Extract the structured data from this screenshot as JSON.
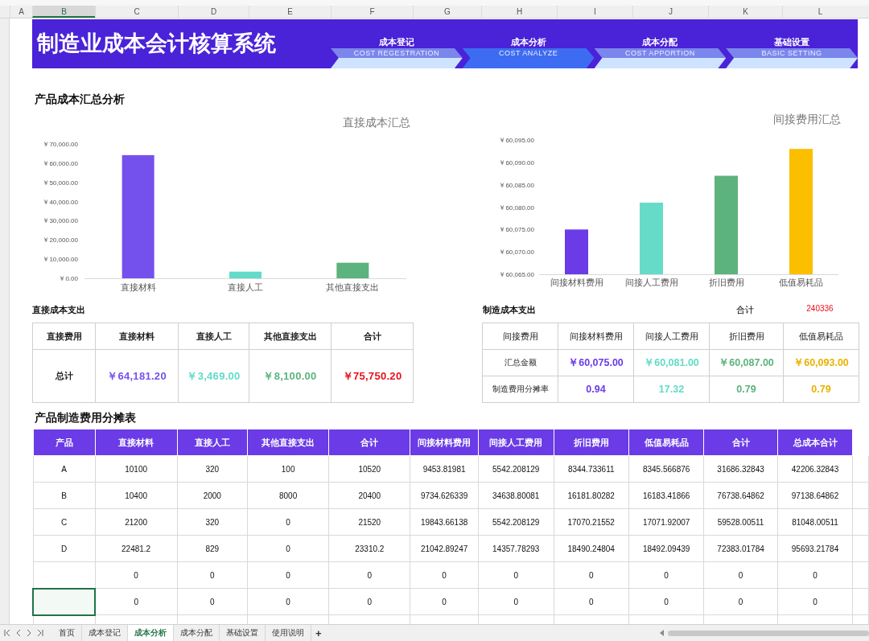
{
  "column_headers": [
    {
      "label": "A",
      "selected": false
    },
    {
      "label": "B",
      "selected": true
    },
    {
      "label": "C",
      "selected": false
    },
    {
      "label": "D",
      "selected": false
    },
    {
      "label": "E",
      "selected": false
    },
    {
      "label": "F",
      "selected": false
    },
    {
      "label": "G",
      "selected": false
    },
    {
      "label": "H",
      "selected": false
    },
    {
      "label": "I",
      "selected": false
    },
    {
      "label": "J",
      "selected": false
    },
    {
      "label": "K",
      "selected": false
    },
    {
      "label": "L",
      "selected": false
    }
  ],
  "banner": {
    "title": "制造业成本会计核算系统",
    "nav": [
      {
        "label": "成本登记",
        "subtitle": "COST REGESTRATION",
        "selected": false
      },
      {
        "label": "成本分析",
        "subtitle": "COST ANALYZE",
        "selected": true
      },
      {
        "label": "成本分配",
        "subtitle": "COST APPORTION",
        "selected": false
      },
      {
        "label": "基础设置",
        "subtitle": "BASIC SETTING",
        "selected": false
      }
    ]
  },
  "section_title": "产品成本汇总分析",
  "direct_chart": {
    "chart_data": {
      "type": "bar",
      "title": "直接成本汇总",
      "categories": [
        "直接材料",
        "直接人工",
        "其他直接支出"
      ],
      "series": [
        {
          "color": "#7451ec",
          "values": [
            64181,
            null,
            null
          ]
        },
        {
          "color": "#63dbc8",
          "values": [
            null,
            3469,
            null
          ]
        },
        {
          "color": "#5cb37d",
          "values": [
            null,
            null,
            8100
          ]
        }
      ],
      "ylim": [
        0,
        70000
      ],
      "yticks": [
        {
          "value": 0,
          "label": "￥0.00"
        },
        {
          "value": 10000,
          "label": "￥10,000.00"
        },
        {
          "value": 20000,
          "label": "￥20,000.00"
        },
        {
          "value": 30000,
          "label": "￥30,000.00"
        },
        {
          "value": 40000,
          "label": "￥40,000.00"
        },
        {
          "value": 50000,
          "label": "￥50,000.00"
        },
        {
          "value": 60000,
          "label": "￥60,000.00"
        },
        {
          "value": 70000,
          "label": "￥70,000.00"
        }
      ]
    }
  },
  "indirect_chart": {
    "chart_data": {
      "type": "bar",
      "title": "间接费用汇总",
      "categories": [
        "间接材料费用",
        "间接人工费用",
        "折旧费用",
        "低值易耗品"
      ],
      "series": [
        {
          "color": "#6a3be6",
          "values": [
            60075,
            null,
            null,
            null
          ]
        },
        {
          "color": "#66dcc8",
          "values": [
            null,
            60081,
            null,
            null
          ]
        },
        {
          "color": "#5cb37d",
          "values": [
            null,
            null,
            60087,
            null
          ]
        },
        {
          "color": "#fbbf00",
          "values": [
            null,
            null,
            null,
            60093
          ]
        }
      ],
      "ylim": [
        60065,
        60095
      ],
      "yticks": [
        {
          "value": 60065,
          "label": "￥60,065.00"
        },
        {
          "value": 60070,
          "label": "￥60,070.00"
        },
        {
          "value": 60075,
          "label": "￥60,075.00"
        },
        {
          "value": 60080,
          "label": "￥60,080.00"
        },
        {
          "value": 60085,
          "label": "￥60,085.00"
        },
        {
          "value": 60090,
          "label": "￥60,090.00"
        },
        {
          "value": 60095,
          "label": "￥60,095.00"
        }
      ]
    }
  },
  "direct_cost": {
    "title": "直接成本支出",
    "header": [
      "直接费用",
      "直接材料",
      "直接人工",
      "其他直接支出",
      "合计"
    ],
    "row_label": "总计",
    "values": [
      {
        "text": "￥64,181.20",
        "color": "#7451ec"
      },
      {
        "text": "￥3,469.00",
        "color": "#63dbc8"
      },
      {
        "text": "￥8,100.00",
        "color": "#5cb37d"
      },
      {
        "text": "￥75,750.20",
        "color": "#e8101a"
      }
    ]
  },
  "manufacturing_cost": {
    "title": "制造成本支出",
    "total_label": "合计",
    "total": "240336",
    "header": [
      "间接费用",
      "间接材料费用",
      "间接人工费用",
      "折旧费用",
      "低值易耗品"
    ],
    "rows": [
      {
        "label": "汇总金额",
        "values": [
          {
            "text": "￥60,075.00",
            "color": "#6a3be6"
          },
          {
            "text": "￥60,081.00",
            "color": "#63dbc8"
          },
          {
            "text": "￥60,087.00",
            "color": "#5cb37d"
          },
          {
            "text": "￥60,093.00",
            "color": "#eab200"
          }
        ]
      },
      {
        "label": "制造费用分摊率",
        "values": [
          {
            "text": "0.94",
            "color": "#6a3be6"
          },
          {
            "text": "17.32",
            "color": "#63dbc8"
          },
          {
            "text": "0.79",
            "color": "#5cb37d"
          },
          {
            "text": "0.79",
            "color": "#eab200"
          }
        ]
      }
    ]
  },
  "allocation": {
    "title": "产品制造费用分摊表",
    "columns": [
      "产品",
      "直接材料",
      "直接人工",
      "其他直接支出",
      "合计",
      "间接材料费用",
      "间接人工费用",
      "折旧费用",
      "低值易耗品",
      "合计",
      "总成本合计"
    ],
    "rows": [
      {
        "product": "A",
        "selected": false,
        "values": [
          "10100",
          "320",
          "100",
          "10520",
          "9453.81981",
          "5542.208129",
          "8344.733611",
          "8345.566876",
          "31686.32843",
          "42206.32843"
        ]
      },
      {
        "product": "B",
        "selected": false,
        "values": [
          "10400",
          "2000",
          "8000",
          "20400",
          "9734.626339",
          "34638.80081",
          "16181.80282",
          "16183.41866",
          "76738.64862",
          "97138.64862"
        ]
      },
      {
        "product": "C",
        "selected": false,
        "values": [
          "21200",
          "320",
          "0",
          "21520",
          "19843.66138",
          "5542.208129",
          "17070.21552",
          "17071.92007",
          "59528.00511",
          "81048.00511"
        ]
      },
      {
        "product": "D",
        "selected": false,
        "values": [
          "22481.2",
          "829",
          "0",
          "23310.2",
          "21042.89247",
          "14357.78293",
          "18490.24804",
          "18492.09439",
          "72383.01784",
          "95693.21784"
        ]
      },
      {
        "selected": false,
        "values": [
          "0",
          "0",
          "0",
          "0",
          "0",
          "0",
          "0",
          "0",
          "0",
          "0"
        ]
      },
      {
        "selected": true,
        "values": [
          "0",
          "0",
          "0",
          "0",
          "0",
          "0",
          "0",
          "0",
          "0",
          "0"
        ]
      }
    ]
  },
  "sheet_tabs": [
    {
      "label": "首页",
      "selected": false
    },
    {
      "label": "成本登记",
      "selected": false
    },
    {
      "label": "成本分析",
      "selected": true
    },
    {
      "label": "成本分配",
      "selected": false
    },
    {
      "label": "基础设置",
      "selected": false
    },
    {
      "label": "使用说明",
      "selected": false
    }
  ],
  "add_sheet": "+"
}
